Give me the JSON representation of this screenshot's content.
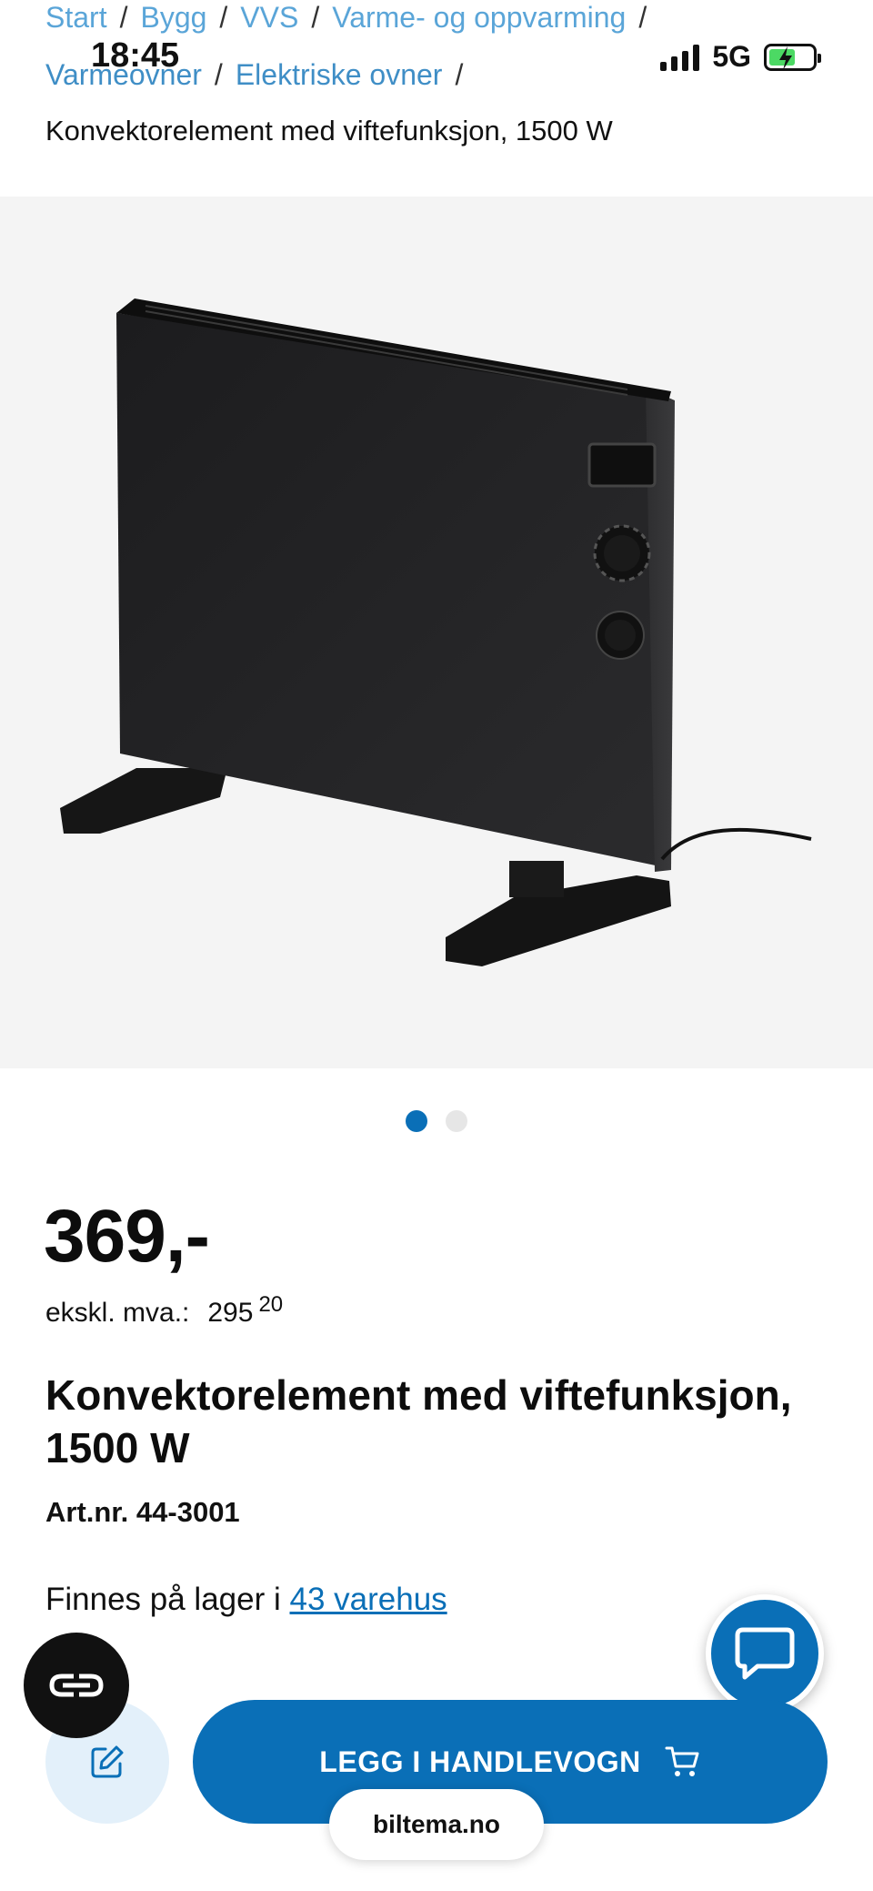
{
  "status_bar": {
    "time": "18:45",
    "network": "5G"
  },
  "breadcrumb": {
    "items": [
      "Start",
      "Bygg",
      "VVS",
      "Varme- og oppvarming",
      "Varmeovner",
      "Elektriske ovner"
    ],
    "separator": "/",
    "current": "Konvektorelement med viftefunksjon, 1500 W"
  },
  "gallery": {
    "image_count": 2,
    "active_index": 0
  },
  "product": {
    "price": "369,-",
    "ex_vat_label": "ekskl. mva.:",
    "ex_vat_main": "295",
    "ex_vat_decimals": "20",
    "title": "Konvektorelement med viftefunksjon, 1500 W",
    "article_number": "Art.nr. 44-3001",
    "stock_prefix": "Finnes på lager i",
    "stock_link": "43 varehus"
  },
  "actions": {
    "add_to_cart": "LEGG I HANDLEVOGN"
  },
  "browser": {
    "url": "biltema.no"
  },
  "colors": {
    "brand_blue": "#0a6fb7",
    "link_blue": "#5aa5d8",
    "light_blue": "#e3f0fa"
  }
}
